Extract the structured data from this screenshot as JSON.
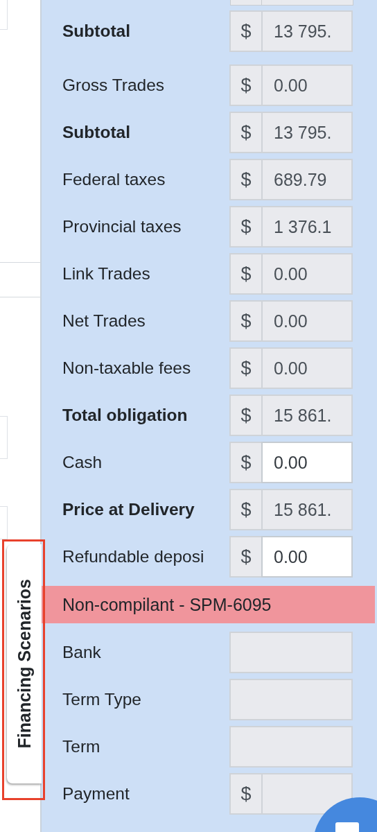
{
  "side_tab": {
    "label": "Financing Scenarios",
    "highlighted": true
  },
  "rows": [
    {
      "label": "Subtotal",
      "bold": true,
      "prefix": "$",
      "value": "13 795.",
      "disabled": true
    },
    {
      "label": "Gross Trades",
      "bold": false,
      "prefix": "$",
      "value": "0.00",
      "disabled": true
    },
    {
      "label": "Subtotal",
      "bold": true,
      "prefix": "$",
      "value": "13 795.",
      "disabled": true
    },
    {
      "label": "Federal taxes",
      "bold": false,
      "prefix": "$",
      "value": "689.79",
      "disabled": true
    },
    {
      "label": "Provincial taxes",
      "bold": false,
      "prefix": "$",
      "value": "1 376.1",
      "disabled": true
    },
    {
      "label": "Link Trades",
      "bold": false,
      "prefix": "$",
      "value": "0.00",
      "disabled": true
    },
    {
      "label": "Net Trades",
      "bold": false,
      "prefix": "$",
      "value": "0.00",
      "disabled": true
    },
    {
      "label": "Non-taxable fees",
      "bold": false,
      "prefix": "$",
      "value": "0.00",
      "disabled": true
    },
    {
      "label": "Total obligation",
      "bold": true,
      "prefix": "$",
      "value": "15 861.",
      "disabled": true
    },
    {
      "label": "Cash",
      "bold": false,
      "prefix": "$",
      "value": "0.00",
      "disabled": false
    },
    {
      "label": "Price at Delivery",
      "bold": true,
      "prefix": "$",
      "value": "15 861.",
      "disabled": true
    },
    {
      "label": "Refundable deposi",
      "bold": false,
      "prefix": "$",
      "value": "0.00",
      "disabled": false
    }
  ],
  "alert": {
    "text": "Non-compilant - SPM-6095"
  },
  "financing_rows": [
    {
      "label": "Bank",
      "bold": false,
      "disabled": true
    },
    {
      "label": "Term Type",
      "bold": false,
      "disabled": true
    },
    {
      "label": "Term",
      "bold": false,
      "disabled": true
    },
    {
      "label": "Payment",
      "bold": false,
      "prefix": "$",
      "disabled": true
    }
  ]
}
